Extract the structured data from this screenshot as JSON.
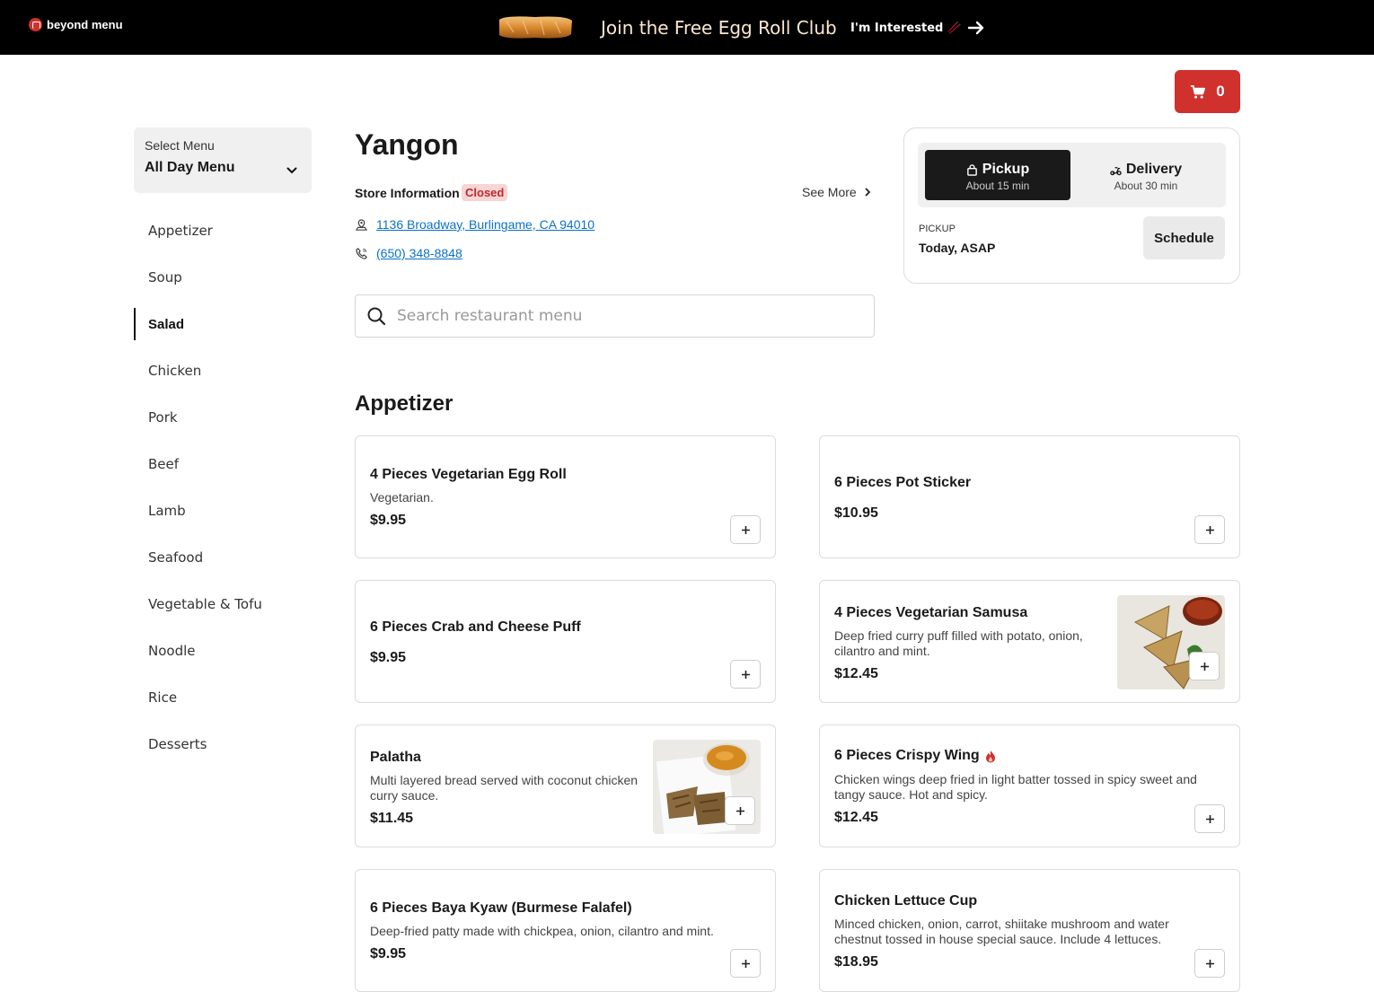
{
  "banner": {
    "logo_text": "beyond menu",
    "promo_text": "Join the Free Egg Roll Club",
    "cta_label": "I'm Interested 🥢"
  },
  "cart": {
    "count": "0"
  },
  "sidebar": {
    "select_label": "Select Menu",
    "select_value": "All Day Menu",
    "categories": [
      {
        "label": "Appetizer"
      },
      {
        "label": "Soup"
      },
      {
        "label": "Salad"
      },
      {
        "label": "Chicken"
      },
      {
        "label": "Pork"
      },
      {
        "label": "Beef"
      },
      {
        "label": "Lamb"
      },
      {
        "label": "Seafood"
      },
      {
        "label": "Vegetable & Tofu"
      },
      {
        "label": "Noodle"
      },
      {
        "label": "Rice"
      },
      {
        "label": "Desserts"
      }
    ],
    "active_category": "Salad"
  },
  "store": {
    "name": "Yangon",
    "info_label": "Store Information",
    "status": "Closed",
    "see_more": "See More",
    "address": "1136 Broadway, Burlingame, CA 94010",
    "phone": "(650) 348-8848"
  },
  "search": {
    "placeholder": "Search restaurant menu"
  },
  "order": {
    "pickup_label": "Pickup",
    "pickup_time": "About 15 min",
    "delivery_label": "Delivery",
    "delivery_time": "About 30 min",
    "selected_mode": "Pickup",
    "schedule_caption": "PICKUP",
    "schedule_value": "Today, ASAP",
    "schedule_button": "Schedule"
  },
  "section": {
    "title": "Appetizer"
  },
  "items": [
    {
      "name": "4 Pieces Vegetarian Egg Roll",
      "desc": "Vegetarian.",
      "price": "$9.95"
    },
    {
      "name": "6 Pieces Pot Sticker",
      "desc": "",
      "price": "$10.95"
    },
    {
      "name": "6 Pieces Crab and Cheese Puff",
      "desc": "",
      "price": "$9.95"
    },
    {
      "name": "4 Pieces Vegetarian Samusa",
      "desc": "Deep fried curry puff filled with potato, onion, cilantro and mint.",
      "price": "$12.45"
    },
    {
      "name": "Palatha",
      "desc": "Multi layered bread served with coconut chicken curry sauce.",
      "price": "$11.45"
    },
    {
      "name": "6 Pieces Crispy Wing",
      "desc": "Chicken wings deep fried in light batter tossed in spicy sweet and tangy sauce. Hot and spicy.",
      "price": "$12.45"
    },
    {
      "name": "6 Pieces Baya Kyaw (Burmese Falafel)",
      "desc": "Deep-fried patty made with chickpea, onion, cilantro and mint.",
      "price": "$9.95"
    },
    {
      "name": "Chicken Lettuce Cup",
      "desc": "Minced chicken, onion, carrot, shiitake mushroom and water chestnut tossed in house special sauce. Include 4 lettuces.",
      "price": "$18.95"
    }
  ],
  "colors": {
    "brand_red": "#d0312d",
    "link_blue": "#0b72c4",
    "closed_bg": "#f9d4d4",
    "banner_bg": "#000000"
  }
}
